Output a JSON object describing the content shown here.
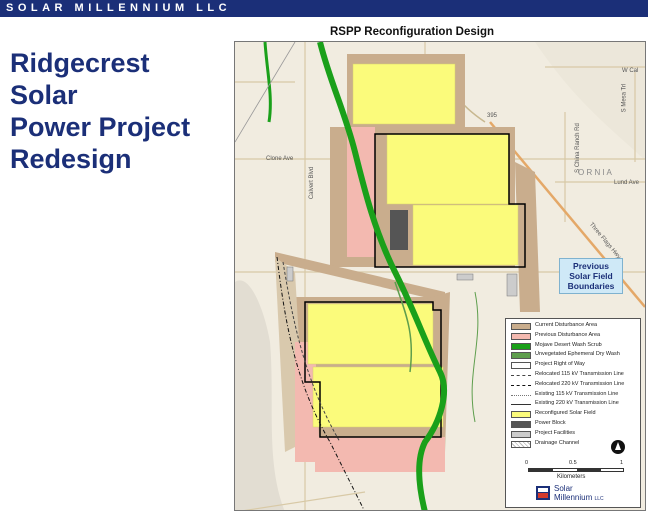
{
  "header": {
    "brand": "SOLAR MILLENNIUM LLC"
  },
  "title": {
    "lines": [
      "Ridgecrest",
      "Solar",
      "Power Project",
      "Redesign"
    ]
  },
  "map": {
    "title": "RSPP Reconfiguration Design",
    "place_labels": {
      "clone_ave": "Clone Ave",
      "calvert_blvd": "Calvert Blvd",
      "w_cal": "W Cal",
      "route_395": "395",
      "orna": "O  R  N  I  A",
      "lund_ave": "Lund Ave",
      "trona_rd": "S China Ranch Rd",
      "three_flags": "Three Flags Hwy",
      "s_mesa": "S Mesa Trl"
    },
    "callout": [
      "Previous",
      "Solar Field",
      "Boundaries"
    ]
  },
  "legend": {
    "items": [
      {
        "label": "Current Disturbance Area",
        "color": "#c9ad8d",
        "style": "fill"
      },
      {
        "label": "Previous Disturbance Area",
        "color": "#f3b9b0",
        "style": "fill"
      },
      {
        "label": "Mojave Desert Wash Scrub",
        "color": "#1aa01a",
        "style": "fill"
      },
      {
        "label": "Unvegetated Ephemeral Dry Wash",
        "color": "#5e9e4d",
        "style": "fill"
      },
      {
        "label": "Project Right of Way",
        "color": "#ffffff",
        "style": "fill"
      },
      {
        "label": "Relocated 115 kV Transmission Line",
        "color": "#444444",
        "style": "dash"
      },
      {
        "label": "Relocated 220 kV Transmission Line",
        "color": "#111111",
        "style": "dashdot"
      },
      {
        "label": "Existing 115 kV Transmission Line",
        "color": "#777777",
        "style": "dots"
      },
      {
        "label": "Existing 220 kV Transmission Line",
        "color": "#333333",
        "style": "line"
      },
      {
        "label": "Reconfigured Solar Field",
        "color": "#fbfb7b",
        "style": "fill"
      },
      {
        "label": "Power Block",
        "color": "#555555",
        "style": "fill"
      },
      {
        "label": "Project Facilities",
        "color": "#cccccc",
        "style": "fill"
      },
      {
        "label": "Drainage Channel",
        "color": "#bbbbbb",
        "style": "hatch"
      }
    ],
    "scale": {
      "ticks": [
        "0",
        "0.5",
        "1"
      ],
      "units": "Kilometers"
    }
  },
  "logo": {
    "line1": "Solar",
    "line2": "Millennium",
    "suffix": "LLC"
  }
}
